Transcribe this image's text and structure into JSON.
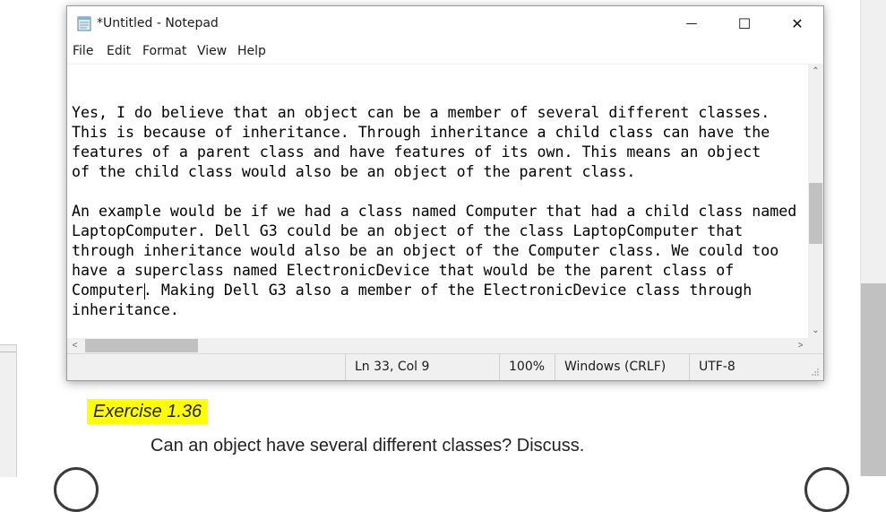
{
  "window": {
    "title": "*Untitled - Notepad",
    "controls": {
      "minimize": "—",
      "maximize": "☐",
      "close": "✕"
    }
  },
  "menu": [
    "File",
    "Edit",
    "Format",
    "View",
    "Help"
  ],
  "editor": {
    "lines": [
      "Yes, I do believe that an object can be a member of several different classes.",
      "This is because of inheritance. Through inheritance a child class can have the",
      "features of a parent class and have features of its own. This means an object",
      "of the child class would also be an object of the parent class.",
      "",
      "An example would be if we had a class named Computer that had a child class named",
      "LaptopComputer. Dell G3 could be an object of the class LaptopComputer that",
      "through inheritance would also be an object of the Computer class. We could too",
      "have a superclass named ElectronicDevice that would be the parent class of",
      "Computer. Making Dell G3 also a member of the ElectronicDevice class through",
      "inheritance."
    ]
  },
  "statusbar": {
    "position": "Ln 33, Col 9",
    "zoom": "100%",
    "line_ending": "Windows (CRLF)",
    "encoding": "UTF-8"
  },
  "scroll_icons": {
    "up": "⌃",
    "down": "⌄",
    "left": "<",
    "right": ">"
  },
  "page": {
    "exercise_heading": "Exercise 1.36",
    "question": "Can an object have several different classes? Discuss."
  },
  "colors": {
    "highlight": "#ffff00",
    "accent": "#1a1a1a"
  }
}
